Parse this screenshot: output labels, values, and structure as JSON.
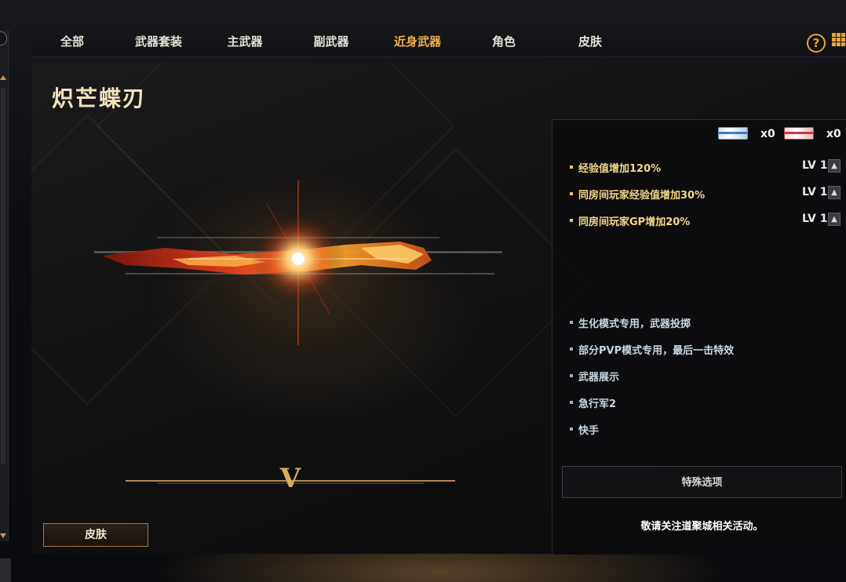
{
  "nav": {
    "tabs": [
      {
        "label": "全部"
      },
      {
        "label": "武器套装"
      },
      {
        "label": "主武器"
      },
      {
        "label": "副武器"
      },
      {
        "label": "近身武器"
      },
      {
        "label": "角色"
      },
      {
        "label": "皮肤"
      }
    ],
    "active_tab": "近身武器",
    "help_label": "?"
  },
  "weapon": {
    "title": "炽芒蝶刃",
    "rank_mark": "V",
    "skin_button_label": "皮肤"
  },
  "tickets": {
    "blue_count": "x0",
    "red_count": "x0"
  },
  "buffs": [
    {
      "text": "经验值增加120%",
      "level": "LV 1"
    },
    {
      "text": "同房间玩家经验值增加30%",
      "level": "LV 1"
    },
    {
      "text": "同房间玩家GP增加20%",
      "level": "LV 1"
    }
  ],
  "features": [
    {
      "text": "生化模式专用，武器投掷"
    },
    {
      "text": "部分PVP模式专用，最后一击特效"
    },
    {
      "text": "武器展示"
    },
    {
      "text": "急行军2"
    },
    {
      "text": "快手"
    }
  ],
  "special_button_label": "特殊选项",
  "notice": "敬请关注道聚城相关活动。",
  "colors": {
    "accent": "#f0b04a",
    "buff_text": "#f2d98a",
    "feature_text": "#c8d6e2"
  }
}
